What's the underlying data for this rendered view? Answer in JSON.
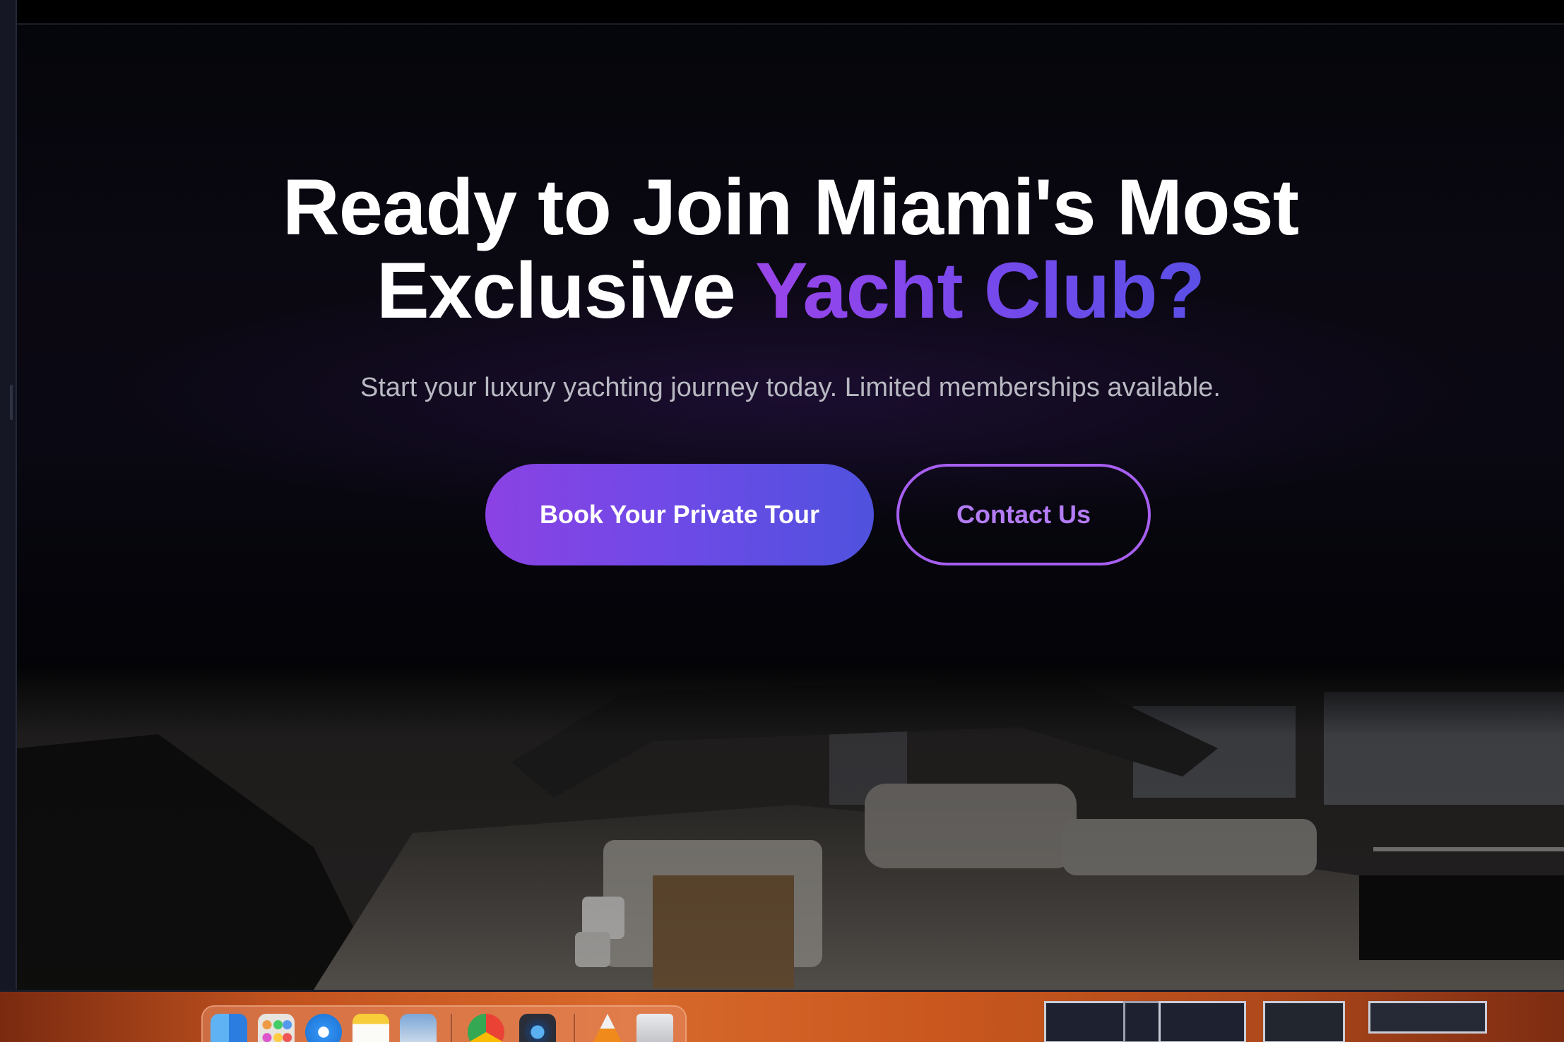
{
  "hero": {
    "title_line1": "Ready to Join Miami's Most",
    "title_line2_plain": "Exclusive",
    "title_line2_accent": "Yacht Club?",
    "subtitle": "Start your luxury yachting journey today. Limited memberships available."
  },
  "buttons": {
    "primary_label": "Book Your Private Tour",
    "secondary_label": "Contact Us"
  },
  "colors": {
    "accent_start": "#9a45ea",
    "accent_end": "#5a4fe6",
    "outline_button": "#a65ff0",
    "background": "#04050a"
  },
  "dock": {
    "apps": [
      "finder-icon",
      "launchpad-icon",
      "safari-icon",
      "notes-icon",
      "preview-icon",
      "chrome-icon",
      "quicktime-icon",
      "vlc-icon",
      "trash-icon"
    ]
  }
}
